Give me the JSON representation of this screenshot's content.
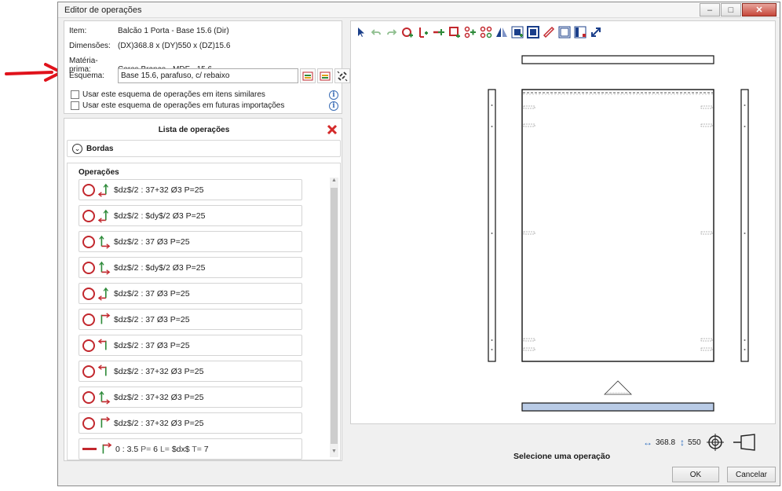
{
  "window": {
    "title": "Editor de operações",
    "min_glyph": "–",
    "max_glyph": "□",
    "close_glyph": "✕"
  },
  "info": {
    "item_label": "Item:",
    "item_value": "Balcão 1 Porta - Base 15.6 (Dir)",
    "dim_label": "Dimensões:",
    "dim_value": "(DX)368.8 x (DY)550 x (DZ)15.6",
    "mat_label": "Matéria-prima:",
    "mat_value": "Cores.Branco - MDF - 15.6",
    "schema_label": "Esquema:",
    "schema_value": "Base 15.6, parafuso, c/ rebaixo",
    "check1": "Usar este esquema de operações em itens similares",
    "check2": "Usar este esquema de operações em futuras importações",
    "info_glyph": "i"
  },
  "list": {
    "title": "Lista de operações",
    "bordas_label": "Bordas",
    "chevron_glyph": "⌄",
    "operacoes_label": "Operações",
    "items": [
      {
        "text": "$dz$/2 : 37+32 Ø3 P=25",
        "axis": "up-left"
      },
      {
        "text": "$dz$/2 : $dy$/2 Ø3 P=25",
        "axis": "up-left"
      },
      {
        "text": "$dz$/2 : 37 Ø3 P=25",
        "axis": "up-right"
      },
      {
        "text": "$dz$/2 : $dy$/2 Ø3 P=25",
        "axis": "up-right"
      },
      {
        "text": "$dz$/2 : 37 Ø3 P=25",
        "axis": "up-left"
      },
      {
        "text": "$dz$/2 : 37 Ø3 P=25",
        "axis": "down-right"
      },
      {
        "text": "$dz$/2 : 37 Ø3 P=25",
        "axis": "down-left"
      },
      {
        "text": "$dz$/2 : 37+32 Ø3 P=25",
        "axis": "down-left"
      },
      {
        "text": "$dz$/2 : 37+32 Ø3 P=25",
        "axis": "up-right"
      },
      {
        "text": "$dz$/2 : 37+32 Ø3 P=25",
        "axis": "down-right"
      }
    ],
    "last_item": {
      "a": "0 : 3.5",
      "p_label": "P=",
      "p_val": " 6",
      "l_label": " L=",
      "l_val": " $dx$",
      "t_label": " T=",
      "t_val": " 7"
    }
  },
  "footer": {
    "dx": "368.8",
    "dy": "550",
    "status": "Selecione uma operação",
    "ok": "OK",
    "cancel": "Cancelar"
  },
  "colors": {
    "accent_red": "#c2272d",
    "edge_blue": "#b9cbe6"
  }
}
